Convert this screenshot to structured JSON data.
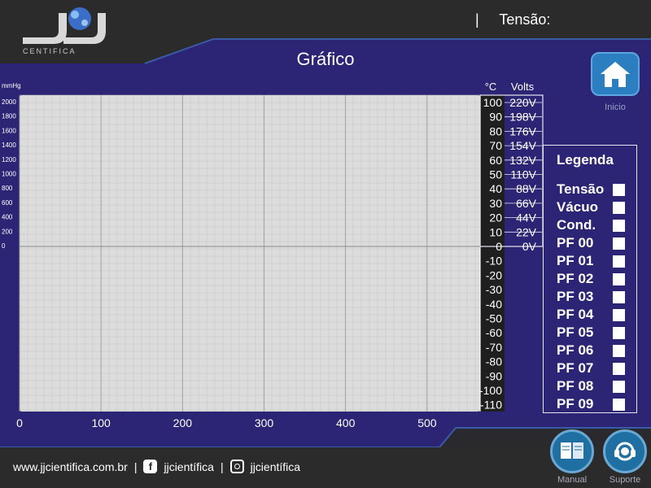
{
  "header": {
    "brand_text": "CENTIFICA",
    "separator": "|",
    "tensao_label": "Tensão:"
  },
  "page": {
    "title": "Gráfico"
  },
  "home": {
    "label": "Inicio"
  },
  "colors": {
    "panel": "#2c2474",
    "plot_bg": "#dcdcdc",
    "axis_strip": "#1f1f1f",
    "dark_bar": "#2b2b2b"
  },
  "chart_data": {
    "type": "line",
    "left_axis_unit": "mmHg",
    "left_axis_ticks": [
      "2000",
      "1800",
      "1600",
      "1400",
      "1200",
      "1000",
      "800",
      "600",
      "400",
      "200",
      "0"
    ],
    "temp_unit": "°C",
    "volts_unit": "Volts",
    "temp_ticks": [
      "100",
      "90",
      "80",
      "70",
      "60",
      "50",
      "40",
      "30",
      "20",
      "10",
      "0",
      "-10",
      "-20",
      "-30",
      "-40",
      "-50",
      "-60",
      "-70",
      "-80",
      "-90",
      "-100",
      "-110"
    ],
    "volt_ticks": [
      "220V",
      "198V",
      "176V",
      "154V",
      "132V",
      "110V",
      "88V",
      "66V",
      "44V",
      "22V",
      "0V"
    ],
    "x_ticks": [
      "0",
      "100",
      "200",
      "300",
      "400",
      "500"
    ],
    "xlim": [
      0,
      565
    ],
    "series": [],
    "grid": true
  },
  "legend": {
    "title": "Legenda",
    "items": [
      "Tensão",
      "Vácuo",
      "Cond.",
      "PF 00",
      "PF 01",
      "PF 02",
      "PF 03",
      "PF 04",
      "PF 05",
      "PF 06",
      "PF 07",
      "PF 08",
      "PF 09"
    ]
  },
  "footer": {
    "website": "www.jjcientifica.com.br",
    "sep": "|",
    "facebook_icon": "facebook-icon",
    "facebook_name": "jjcientífica",
    "instagram_icon": "instagram-icon",
    "instagram_name": "jjcientífica"
  },
  "manual": {
    "label": "Manual"
  },
  "suporte": {
    "label": "Suporte"
  }
}
